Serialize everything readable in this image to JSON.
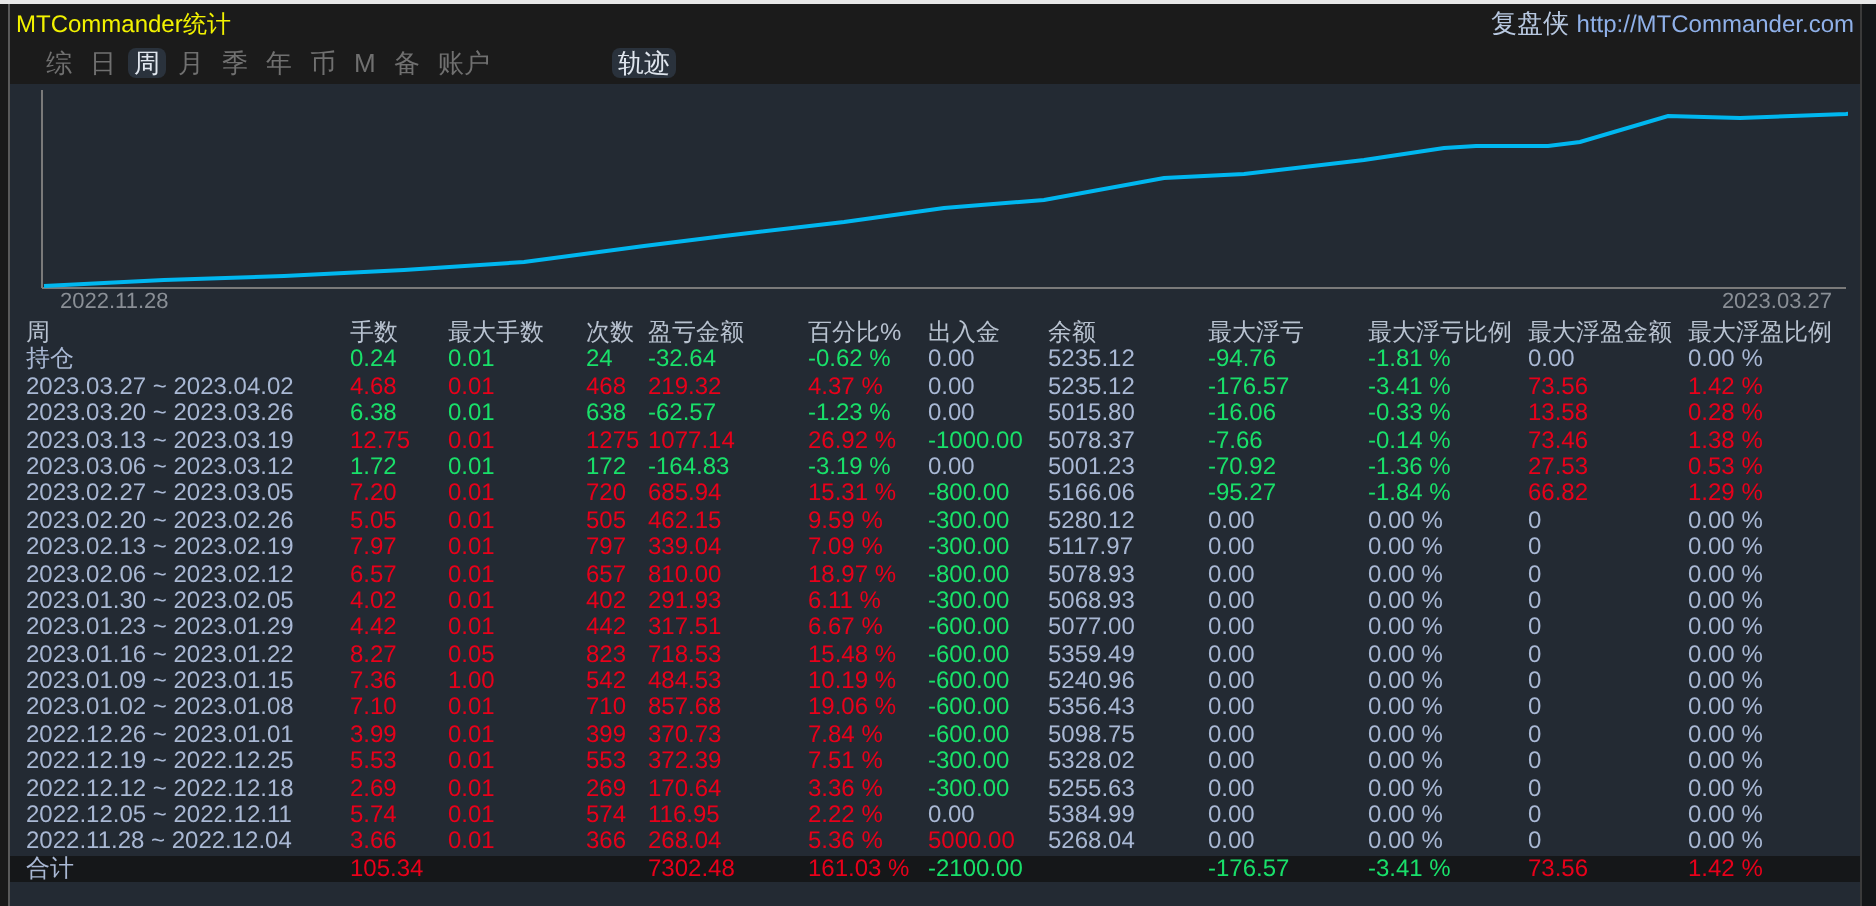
{
  "title": "MTCommander统计",
  "brand": {
    "name": "复盘侠",
    "url": "http://MTCommander.com"
  },
  "tabs": [
    {
      "label": "综",
      "selected": false
    },
    {
      "label": "日",
      "selected": false
    },
    {
      "label": "周",
      "selected": true
    },
    {
      "label": "月",
      "selected": false
    },
    {
      "label": "季",
      "selected": false
    },
    {
      "label": "年",
      "selected": false
    },
    {
      "label": "币",
      "selected": false
    },
    {
      "label": "M",
      "selected": false
    },
    {
      "label": "备",
      "selected": false
    },
    {
      "label": "账户",
      "selected": false
    }
  ],
  "track_button": {
    "label": "轨迹",
    "selected": true
  },
  "chart": {
    "start_label": "2022.11.28",
    "end_label": "2023.03.27"
  },
  "table": {
    "columns": [
      "周",
      "手数",
      "最大手数",
      "次数",
      "盈亏金额",
      "百分比%",
      "出入金",
      "余额",
      "最大浮亏",
      "最大浮亏比例",
      "最大浮盈金额",
      "最大浮盈比例"
    ],
    "rows": [
      {
        "cells": [
          "持仓",
          {
            "v": "0.24",
            "color": "#19e06a"
          },
          {
            "v": "0.01",
            "color": "#19e06a"
          },
          {
            "v": "24",
            "color": "#19e06a"
          },
          {
            "v": "-32.64",
            "color": "#19e06a"
          },
          {
            "v": "-0.62 %",
            "color": "#19e06a"
          },
          "0.00",
          "5235.12",
          {
            "v": "-94.76",
            "color": "#19e06a"
          },
          {
            "v": "-1.81 %",
            "color": "#19e06a"
          },
          "0.00",
          "0.00 %"
        ]
      },
      {
        "cells": [
          "2023.03.27 ~ 2023.04.02",
          {
            "v": "4.68",
            "color": "#e8001a"
          },
          {
            "v": "0.01",
            "color": "#e8001a"
          },
          {
            "v": "468",
            "color": "#e8001a"
          },
          {
            "v": "219.32",
            "color": "#e8001a"
          },
          {
            "v": "4.37 %",
            "color": "#e8001a"
          },
          "0.00",
          "5235.12",
          {
            "v": "-176.57",
            "color": "#19e06a"
          },
          {
            "v": "-3.41 %",
            "color": "#19e06a"
          },
          {
            "v": "73.56",
            "color": "#e8001a"
          },
          {
            "v": "1.42 %",
            "color": "#e8001a"
          }
        ]
      },
      {
        "cells": [
          "2023.03.20 ~ 2023.03.26",
          {
            "v": "6.38",
            "color": "#19e06a"
          },
          {
            "v": "0.01",
            "color": "#19e06a"
          },
          {
            "v": "638",
            "color": "#19e06a"
          },
          {
            "v": "-62.57",
            "color": "#19e06a"
          },
          {
            "v": "-1.23 %",
            "color": "#19e06a"
          },
          "0.00",
          "5015.80",
          {
            "v": "-16.06",
            "color": "#19e06a"
          },
          {
            "v": "-0.33 %",
            "color": "#19e06a"
          },
          {
            "v": "13.58",
            "color": "#e8001a"
          },
          {
            "v": "0.28 %",
            "color": "#e8001a"
          }
        ]
      },
      {
        "cells": [
          "2023.03.13 ~ 2023.03.19",
          {
            "v": "12.75",
            "color": "#e8001a"
          },
          {
            "v": "0.01",
            "color": "#e8001a"
          },
          {
            "v": "1275",
            "color": "#e8001a"
          },
          {
            "v": "1077.14",
            "color": "#e8001a"
          },
          {
            "v": "26.92 %",
            "color": "#e8001a"
          },
          {
            "v": "-1000.00",
            "color": "#19e06a"
          },
          "5078.37",
          {
            "v": "-7.66",
            "color": "#19e06a"
          },
          {
            "v": "-0.14 %",
            "color": "#19e06a"
          },
          {
            "v": "73.46",
            "color": "#e8001a"
          },
          {
            "v": "1.38 %",
            "color": "#e8001a"
          }
        ]
      },
      {
        "cells": [
          "2023.03.06 ~ 2023.03.12",
          {
            "v": "1.72",
            "color": "#19e06a"
          },
          {
            "v": "0.01",
            "color": "#19e06a"
          },
          {
            "v": "172",
            "color": "#19e06a"
          },
          {
            "v": "-164.83",
            "color": "#19e06a"
          },
          {
            "v": "-3.19 %",
            "color": "#19e06a"
          },
          "0.00",
          "5001.23",
          {
            "v": "-70.92",
            "color": "#19e06a"
          },
          {
            "v": "-1.36 %",
            "color": "#19e06a"
          },
          {
            "v": "27.53",
            "color": "#e8001a"
          },
          {
            "v": "0.53 %",
            "color": "#e8001a"
          }
        ]
      },
      {
        "cells": [
          "2023.02.27 ~ 2023.03.05",
          {
            "v": "7.20",
            "color": "#e8001a"
          },
          {
            "v": "0.01",
            "color": "#e8001a"
          },
          {
            "v": "720",
            "color": "#e8001a"
          },
          {
            "v": "685.94",
            "color": "#e8001a"
          },
          {
            "v": "15.31 %",
            "color": "#e8001a"
          },
          {
            "v": "-800.00",
            "color": "#19e06a"
          },
          "5166.06",
          {
            "v": "-95.27",
            "color": "#19e06a"
          },
          {
            "v": "-1.84 %",
            "color": "#19e06a"
          },
          {
            "v": "66.82",
            "color": "#e8001a"
          },
          {
            "v": "1.29 %",
            "color": "#e8001a"
          }
        ]
      },
      {
        "cells": [
          "2023.02.20 ~ 2023.02.26",
          {
            "v": "5.05",
            "color": "#e8001a"
          },
          {
            "v": "0.01",
            "color": "#e8001a"
          },
          {
            "v": "505",
            "color": "#e8001a"
          },
          {
            "v": "462.15",
            "color": "#e8001a"
          },
          {
            "v": "9.59 %",
            "color": "#e8001a"
          },
          {
            "v": "-300.00",
            "color": "#19e06a"
          },
          "5280.12",
          "0.00",
          "0.00 %",
          "0",
          "0.00 %"
        ]
      },
      {
        "cells": [
          "2023.02.13 ~ 2023.02.19",
          {
            "v": "7.97",
            "color": "#e8001a"
          },
          {
            "v": "0.01",
            "color": "#e8001a"
          },
          {
            "v": "797",
            "color": "#e8001a"
          },
          {
            "v": "339.04",
            "color": "#e8001a"
          },
          {
            "v": "7.09 %",
            "color": "#e8001a"
          },
          {
            "v": "-300.00",
            "color": "#19e06a"
          },
          "5117.97",
          "0.00",
          "0.00 %",
          "0",
          "0.00 %"
        ]
      },
      {
        "cells": [
          "2023.02.06 ~ 2023.02.12",
          {
            "v": "6.57",
            "color": "#e8001a"
          },
          {
            "v": "0.01",
            "color": "#e8001a"
          },
          {
            "v": "657",
            "color": "#e8001a"
          },
          {
            "v": "810.00",
            "color": "#e8001a"
          },
          {
            "v": "18.97 %",
            "color": "#e8001a"
          },
          {
            "v": "-800.00",
            "color": "#19e06a"
          },
          "5078.93",
          "0.00",
          "0.00 %",
          "0",
          "0.00 %"
        ]
      },
      {
        "cells": [
          "2023.01.30 ~ 2023.02.05",
          {
            "v": "4.02",
            "color": "#e8001a"
          },
          {
            "v": "0.01",
            "color": "#e8001a"
          },
          {
            "v": "402",
            "color": "#e8001a"
          },
          {
            "v": "291.93",
            "color": "#e8001a"
          },
          {
            "v": "6.11 %",
            "color": "#e8001a"
          },
          {
            "v": "-300.00",
            "color": "#19e06a"
          },
          "5068.93",
          "0.00",
          "0.00 %",
          "0",
          "0.00 %"
        ]
      },
      {
        "cells": [
          "2023.01.23 ~ 2023.01.29",
          {
            "v": "4.42",
            "color": "#e8001a"
          },
          {
            "v": "0.01",
            "color": "#e8001a"
          },
          {
            "v": "442",
            "color": "#e8001a"
          },
          {
            "v": "317.51",
            "color": "#e8001a"
          },
          {
            "v": "6.67 %",
            "color": "#e8001a"
          },
          {
            "v": "-600.00",
            "color": "#19e06a"
          },
          "5077.00",
          "0.00",
          "0.00 %",
          "0",
          "0.00 %"
        ]
      },
      {
        "cells": [
          "2023.01.16 ~ 2023.01.22",
          {
            "v": "8.27",
            "color": "#e8001a"
          },
          {
            "v": "0.05",
            "color": "#e8001a"
          },
          {
            "v": "823",
            "color": "#e8001a"
          },
          {
            "v": "718.53",
            "color": "#e8001a"
          },
          {
            "v": "15.48 %",
            "color": "#e8001a"
          },
          {
            "v": "-600.00",
            "color": "#19e06a"
          },
          "5359.49",
          "0.00",
          "0.00 %",
          "0",
          "0.00 %"
        ]
      },
      {
        "cells": [
          "2023.01.09 ~ 2023.01.15",
          {
            "v": "7.36",
            "color": "#e8001a"
          },
          {
            "v": "1.00",
            "color": "#e8001a"
          },
          {
            "v": "542",
            "color": "#e8001a"
          },
          {
            "v": "484.53",
            "color": "#e8001a"
          },
          {
            "v": "10.19 %",
            "color": "#e8001a"
          },
          {
            "v": "-600.00",
            "color": "#19e06a"
          },
          "5240.96",
          "0.00",
          "0.00 %",
          "0",
          "0.00 %"
        ]
      },
      {
        "cells": [
          "2023.01.02 ~ 2023.01.08",
          {
            "v": "7.10",
            "color": "#e8001a"
          },
          {
            "v": "0.01",
            "color": "#e8001a"
          },
          {
            "v": "710",
            "color": "#e8001a"
          },
          {
            "v": "857.68",
            "color": "#e8001a"
          },
          {
            "v": "19.06 %",
            "color": "#e8001a"
          },
          {
            "v": "-600.00",
            "color": "#19e06a"
          },
          "5356.43",
          "0.00",
          "0.00 %",
          "0",
          "0.00 %"
        ]
      },
      {
        "cells": [
          "2022.12.26 ~ 2023.01.01",
          {
            "v": "3.99",
            "color": "#e8001a"
          },
          {
            "v": "0.01",
            "color": "#e8001a"
          },
          {
            "v": "399",
            "color": "#e8001a"
          },
          {
            "v": "370.73",
            "color": "#e8001a"
          },
          {
            "v": "7.84 %",
            "color": "#e8001a"
          },
          {
            "v": "-600.00",
            "color": "#19e06a"
          },
          "5098.75",
          "0.00",
          "0.00 %",
          "0",
          "0.00 %"
        ]
      },
      {
        "cells": [
          "2022.12.19 ~ 2022.12.25",
          {
            "v": "5.53",
            "color": "#e8001a"
          },
          {
            "v": "0.01",
            "color": "#e8001a"
          },
          {
            "v": "553",
            "color": "#e8001a"
          },
          {
            "v": "372.39",
            "color": "#e8001a"
          },
          {
            "v": "7.51 %",
            "color": "#e8001a"
          },
          {
            "v": "-300.00",
            "color": "#19e06a"
          },
          "5328.02",
          "0.00",
          "0.00 %",
          "0",
          "0.00 %"
        ]
      },
      {
        "cells": [
          "2022.12.12 ~ 2022.12.18",
          {
            "v": "2.69",
            "color": "#e8001a"
          },
          {
            "v": "0.01",
            "color": "#e8001a"
          },
          {
            "v": "269",
            "color": "#e8001a"
          },
          {
            "v": "170.64",
            "color": "#e8001a"
          },
          {
            "v": "3.36 %",
            "color": "#e8001a"
          },
          {
            "v": "-300.00",
            "color": "#19e06a"
          },
          "5255.63",
          "0.00",
          "0.00 %",
          "0",
          "0.00 %"
        ]
      },
      {
        "cells": [
          "2022.12.05 ~ 2022.12.11",
          {
            "v": "5.74",
            "color": "#e8001a"
          },
          {
            "v": "0.01",
            "color": "#e8001a"
          },
          {
            "v": "574",
            "color": "#e8001a"
          },
          {
            "v": "116.95",
            "color": "#e8001a"
          },
          {
            "v": "2.22 %",
            "color": "#e8001a"
          },
          "0.00",
          "5384.99",
          "0.00",
          "0.00 %",
          "0",
          "0.00 %"
        ]
      },
      {
        "cells": [
          "2022.11.28 ~ 2022.12.04",
          {
            "v": "3.66",
            "color": "#e8001a"
          },
          {
            "v": "0.01",
            "color": "#e8001a"
          },
          {
            "v": "366",
            "color": "#e8001a"
          },
          {
            "v": "268.04",
            "color": "#e8001a"
          },
          {
            "v": "5.36 %",
            "color": "#e8001a"
          },
          {
            "v": "5000.00",
            "color": "#e8001a"
          },
          "5268.04",
          "0.00",
          "0.00 %",
          "0",
          "0.00 %"
        ]
      }
    ],
    "total": {
      "cells": [
        "合计",
        {
          "v": "105.34",
          "color": "#e8001a"
        },
        "",
        "",
        {
          "v": "7302.48",
          "color": "#e8001a"
        },
        {
          "v": "161.03 %",
          "color": "#e8001a"
        },
        {
          "v": "-2100.00",
          "color": "#19e06a"
        },
        "",
        {
          "v": "-176.57",
          "color": "#19e06a"
        },
        {
          "v": "-3.41 %",
          "color": "#19e06a"
        },
        {
          "v": "73.56",
          "color": "#e8001a"
        },
        {
          "v": "1.42 %",
          "color": "#e8001a"
        }
      ]
    }
  }
}
